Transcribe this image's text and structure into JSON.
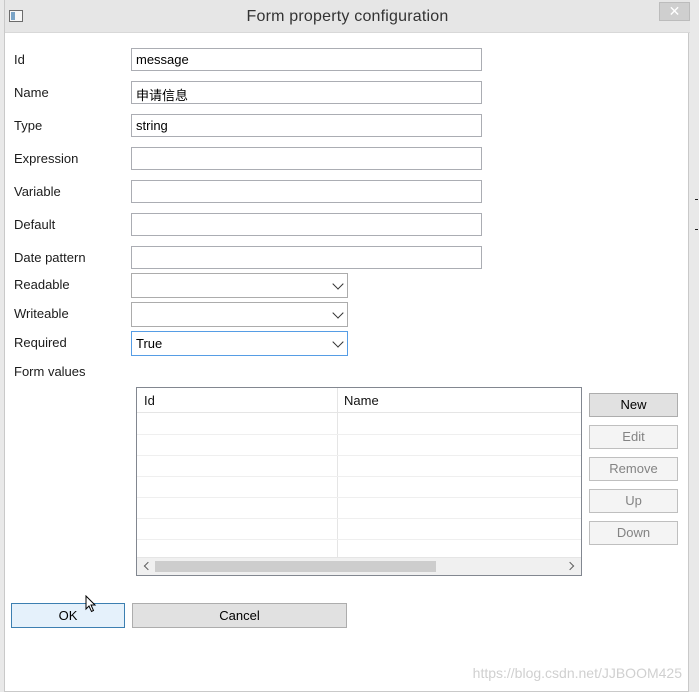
{
  "window": {
    "title": "Form property configuration",
    "close_glyph": "✕"
  },
  "fields": {
    "id": {
      "label": "Id",
      "value": "message"
    },
    "name": {
      "label": "Name",
      "value": "申请信息"
    },
    "type": {
      "label": "Type",
      "value": "string"
    },
    "expression": {
      "label": "Expression",
      "value": ""
    },
    "variable": {
      "label": "Variable",
      "value": ""
    },
    "default": {
      "label": "Default",
      "value": ""
    },
    "date_pattern": {
      "label": "Date pattern",
      "value": ""
    },
    "readable": {
      "label": "Readable",
      "value": ""
    },
    "writeable": {
      "label": "Writeable",
      "value": ""
    },
    "required": {
      "label": "Required",
      "value": "True"
    }
  },
  "form_values": {
    "label": "Form values",
    "columns": [
      "Id",
      "Name"
    ],
    "rows": [],
    "buttons": {
      "new": "New",
      "edit": "Edit",
      "remove": "Remove",
      "up": "Up",
      "down": "Down"
    }
  },
  "footer": {
    "ok": "OK",
    "cancel": "Cancel"
  },
  "watermark": "https://blog.csdn.net/JJBOOM425",
  "colors": {
    "focus_border": "#569de5",
    "default_button_border": "#3c7fb1",
    "titlebar": "#e6e6e6"
  }
}
